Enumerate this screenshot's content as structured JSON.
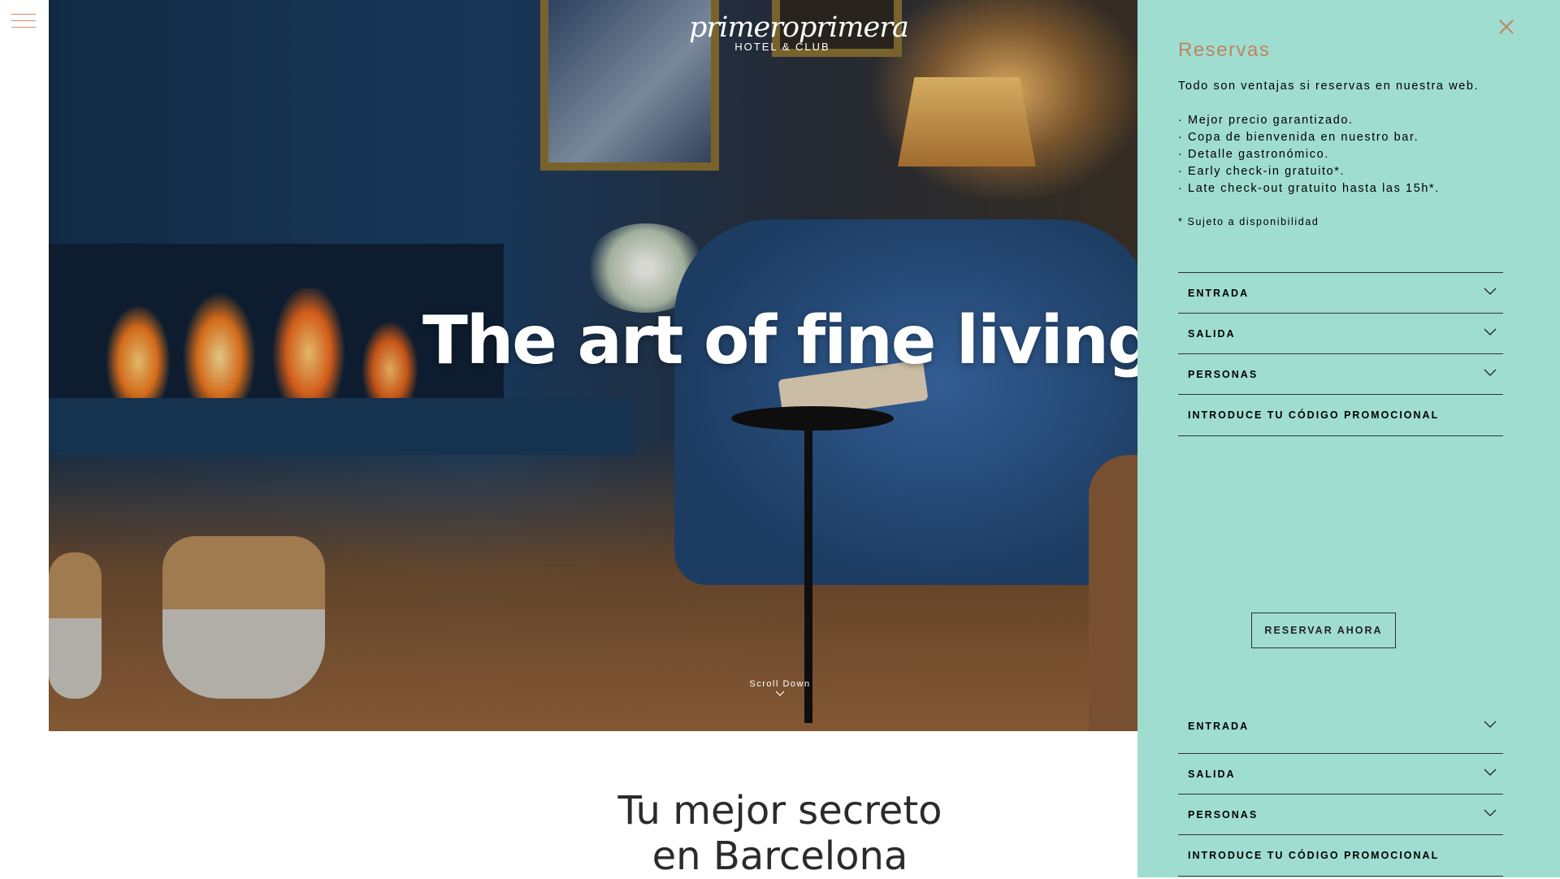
{
  "brand": {
    "logo_main": "primeroprimera",
    "logo_sub": "HOTEL & CLUB"
  },
  "hero": {
    "headline": "The art of fine living",
    "scroll_label": "Scroll Down"
  },
  "section": {
    "tagline_line1": "Tu mejor secreto",
    "tagline_line2": "en Barcelona"
  },
  "reservations": {
    "title": "Reservas",
    "intro": "Todo son ventajas si reservas en nuestra web.",
    "benefits": [
      "· Mejor precio garantizado.",
      "· Copa de bienvenida en nuestro bar.",
      "· Detalle gastronómico.",
      "· Early check-in gratuito*.",
      "· Late check-out gratuito hasta las 15h*."
    ],
    "note": "* Sujeto a disponibilidad",
    "fields": {
      "checkin": "ENTRADA",
      "checkout": "SALIDA",
      "guests": "PERSONAS",
      "promo": "INTRODUCE TU CÓDIGO PROMOCIONAL"
    },
    "cta": "RESERVAR AHORA"
  },
  "colors": {
    "panel_bg": "#9fddd0",
    "accent": "#c08461"
  },
  "icons": {
    "menu": "hamburger-icon",
    "close": "close-icon",
    "chevron": "chevron-down-icon"
  }
}
